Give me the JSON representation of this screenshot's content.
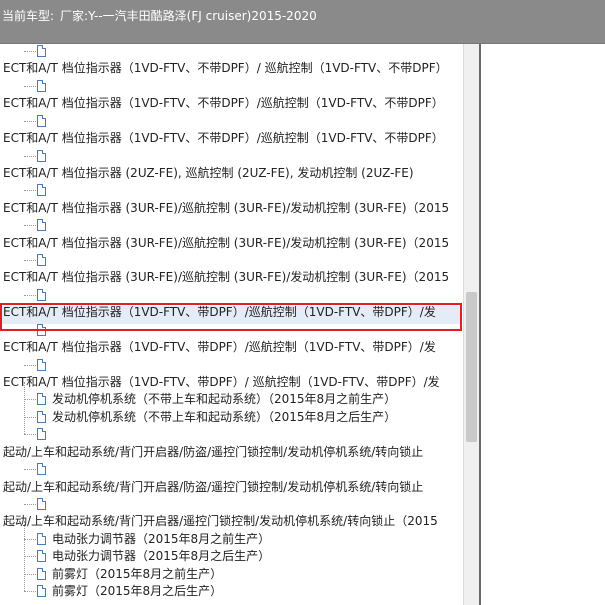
{
  "header": {
    "label": "当前车型:",
    "model": "厂家:Y--一汽丰田酷路泽(FJ cruiser)2015-2020"
  },
  "tree": {
    "rows": [
      {
        "kind": "sub",
        "text": ""
      },
      {
        "kind": "item",
        "text": "ECT和A/T 档位指示器（1VD-FTV、不带DPF）/ 巡航控制（1VD-FTV、不带DPF）"
      },
      {
        "kind": "sub",
        "text": ""
      },
      {
        "kind": "item",
        "text": "ECT和A/T 档位指示器（1VD-FTV、不带DPF）/巡航控制（1VD-FTV、不带DPF）"
      },
      {
        "kind": "sub",
        "text": ""
      },
      {
        "kind": "item",
        "text": "ECT和A/T 档位指示器（1VD-FTV、不带DPF）/巡航控制（1VD-FTV、不带DPF）"
      },
      {
        "kind": "sub",
        "text": ""
      },
      {
        "kind": "item",
        "text": "ECT和A/T 档位指示器 (2UZ-FE), 巡航控制 (2UZ-FE), 发动机控制 (2UZ-FE)"
      },
      {
        "kind": "sub",
        "text": ""
      },
      {
        "kind": "item",
        "text": "ECT和A/T 档位指示器 (3UR-FE)/巡航控制 (3UR-FE)/发动机控制 (3UR-FE)（2015"
      },
      {
        "kind": "sub",
        "text": ""
      },
      {
        "kind": "item",
        "text": "ECT和A/T 档位指示器 (3UR-FE)/巡航控制 (3UR-FE)/发动机控制 (3UR-FE)（2015"
      },
      {
        "kind": "sub",
        "text": ""
      },
      {
        "kind": "item",
        "text": "ECT和A/T 档位指示器 (3UR-FE)/巡航控制 (3UR-FE)/发动机控制 (3UR-FE)（2015"
      },
      {
        "kind": "sub",
        "text": ""
      },
      {
        "kind": "item",
        "text": "ECT和A/T 档位指示器（1VD-FTV、带DPF）/巡航控制（1VD-FTV、带DPF）/发"
      },
      {
        "kind": "sub",
        "text": ""
      },
      {
        "kind": "item",
        "text": "ECT和A/T 档位指示器（1VD-FTV、带DPF）/巡航控制（1VD-FTV、带DPF）/发"
      },
      {
        "kind": "sub",
        "text": ""
      },
      {
        "kind": "item",
        "text": "ECT和A/T 档位指示器（1VD-FTV、带DPF）/ 巡航控制（1VD-FTV、带DPF）/发"
      },
      {
        "kind": "sub",
        "text": "发动机停机系统（不带上车和起动系统）（2015年8月之前生产）"
      },
      {
        "kind": "sub",
        "text": "发动机停机系统（不带上车和起动系统）（2015年8月之后生产）"
      },
      {
        "kind": "sub",
        "text": ""
      },
      {
        "kind": "item",
        "text": "起动/上车和起动系统/背门开启器/防盗/遥控门锁控制/发动机停机系统/转向锁止"
      },
      {
        "kind": "sub",
        "text": ""
      },
      {
        "kind": "item",
        "text": "起动/上车和起动系统/背门开启器/防盗/遥控门锁控制/发动机停机系统/转向锁止"
      },
      {
        "kind": "sub",
        "text": ""
      },
      {
        "kind": "item",
        "text": "起动/上车和起动系统/背门开启器/遥控门锁控制/发动机停机系统/转向锁止（2015"
      },
      {
        "kind": "sub",
        "text": "电动张力调节器（2015年8月之前生产）"
      },
      {
        "kind": "sub",
        "text": "电动张力调节器（2015年8月之后生产）"
      },
      {
        "kind": "sub",
        "text": "前雾灯（2015年8月之前生产）"
      },
      {
        "kind": "sub",
        "text": "前雾灯（2015年8月之后生产）"
      }
    ]
  },
  "colors": {
    "header_bg": "#8a8a8a",
    "highlight_border": "#e02020",
    "selection_bg": "#e4ecf7"
  }
}
